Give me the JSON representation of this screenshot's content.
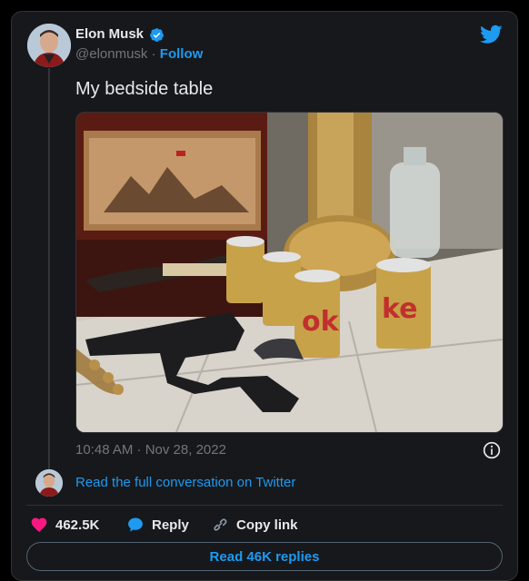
{
  "author": {
    "name": "Elon Musk",
    "handle": "@elonmusk",
    "separator": "·",
    "follow_label": "Follow"
  },
  "tweet": {
    "text": "My bedside table",
    "timestamp": "10:48 AM · Nov 28, 2022"
  },
  "thread": {
    "read_full_label": "Read the full conversation on Twitter"
  },
  "actions": {
    "likes_count": "462.5K",
    "reply_label": "Reply",
    "copy_link_label": "Copy link"
  },
  "replies_button_label": "Read 46K replies",
  "colors": {
    "accent": "#1d9bf0",
    "like": "#f91880",
    "background": "#16181c",
    "text": "#e7e9ea",
    "muted": "#71767b"
  },
  "icons": [
    "verified-badge-icon",
    "twitter-bird-icon",
    "info-icon",
    "heart-icon",
    "reply-bubble-icon",
    "link-icon"
  ]
}
